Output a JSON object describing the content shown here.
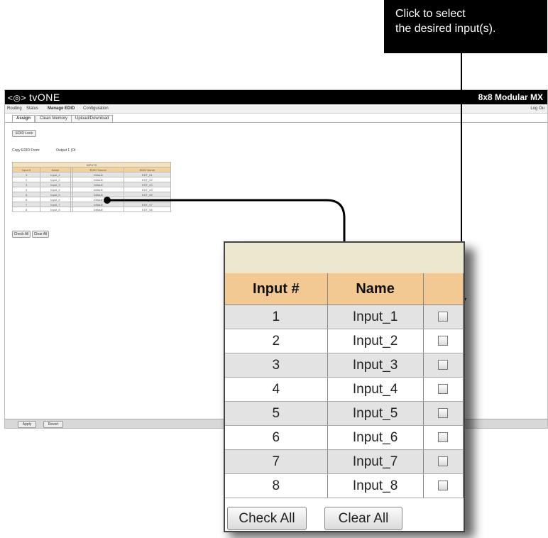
{
  "callout": {
    "text": "Click to select\nthe desired input(s)."
  },
  "app": {
    "logo": "tvONE",
    "logo_glyph": "<◎>",
    "product": "8x8 Modular MX",
    "logout": "Log Ou",
    "menu": [
      "Routing",
      "Status",
      "Manage EDID",
      "Configuration"
    ],
    "tabs": [
      "Assign",
      "Clean Memory",
      "Upload/Download"
    ],
    "edid_lock_button": "EDID Lock",
    "copy_from_label": "Copy EDID From:",
    "copy_from_value": "Output 1 (Or",
    "table_title": "INPUTS",
    "mini_headers": [
      "Input #",
      "Name",
      "",
      "EDID Source",
      "EDID Name"
    ],
    "mini_rows": [
      [
        "1",
        "Input_1",
        "Default",
        "EDT_01"
      ],
      [
        "2",
        "Input_2",
        "Default",
        "EDT_02"
      ],
      [
        "3",
        "Input_3",
        "Default",
        "EDT_03"
      ],
      [
        "4",
        "Input_4",
        "Default",
        "EDT_04"
      ],
      [
        "5",
        "Input_5",
        "Default",
        "EDT_05"
      ],
      [
        "6",
        "Input_6",
        "Default",
        "EDT_06"
      ],
      [
        "7",
        "Input_7",
        "Default",
        "EDT_07"
      ],
      [
        "8",
        "Input_8",
        "Default",
        "EDT_08"
      ]
    ],
    "check_all": "Check All",
    "clear_all": "Clear All",
    "apply_button": "Apply",
    "revert_button": "Revert"
  },
  "zoom": {
    "headers": {
      "input_num": "Input #",
      "name": "Name",
      "select": ""
    },
    "rows": [
      {
        "num": "1",
        "name": "Input_1",
        "checked": false
      },
      {
        "num": "2",
        "name": "Input_2",
        "checked": false
      },
      {
        "num": "3",
        "name": "Input_3",
        "checked": false
      },
      {
        "num": "4",
        "name": "Input_4",
        "checked": false
      },
      {
        "num": "5",
        "name": "Input_5",
        "checked": false
      },
      {
        "num": "6",
        "name": "Input_6",
        "checked": false
      },
      {
        "num": "7",
        "name": "Input_7",
        "checked": false
      },
      {
        "num": "8",
        "name": "Input_8",
        "checked": false
      }
    ],
    "check_all": "Check All",
    "clear_all": "Clear All"
  },
  "colors": {
    "header_orange": "#f2c993",
    "title_band": "#ece8cf",
    "row_shade": "#e3e3e3"
  }
}
